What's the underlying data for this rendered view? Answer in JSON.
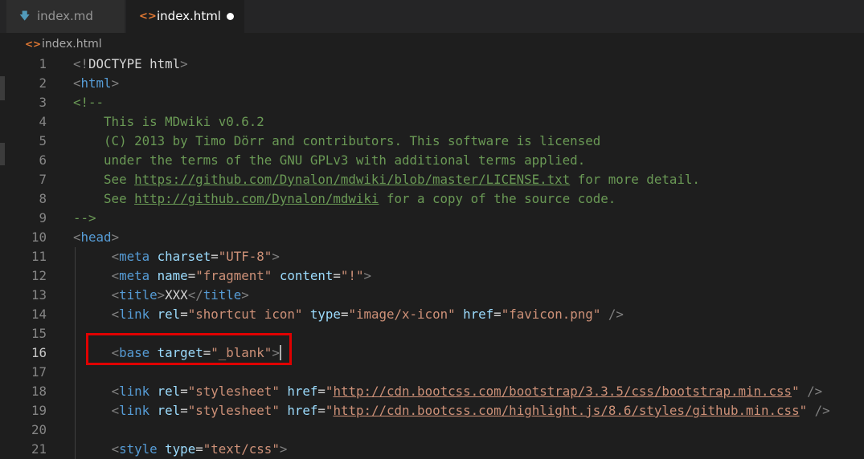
{
  "tabs": [
    {
      "label": "index.md",
      "icon": "markdown-file-icon",
      "active": false
    },
    {
      "label": "index.html",
      "icon": "html-file-icon",
      "active": true,
      "dirty": true
    }
  ],
  "breadcrumb": {
    "file": "index.html"
  },
  "editor": {
    "current_line": 16,
    "lines": [
      {
        "n": "1",
        "t": [
          [
            "punc",
            "<!"
          ],
          [
            "plain",
            "DOCTYPE html"
          ],
          [
            "punc",
            ">"
          ]
        ]
      },
      {
        "n": "2",
        "t": [
          [
            "punc",
            "<"
          ],
          [
            "tagn",
            "html"
          ],
          [
            "punc",
            ">"
          ]
        ]
      },
      {
        "n": "3",
        "t": [
          [
            "cmt",
            "<!--"
          ]
        ]
      },
      {
        "n": "4",
        "t": [
          [
            "cmt",
            "    This is MDwiki v0.6.2"
          ]
        ]
      },
      {
        "n": "5",
        "t": [
          [
            "cmt",
            "    (C) 2013 by Timo Dörr and contributors. This software is licensed"
          ]
        ]
      },
      {
        "n": "6",
        "t": [
          [
            "cmt",
            "    under the terms of the GNU GPLv3 with additional terms applied."
          ]
        ]
      },
      {
        "n": "7",
        "t": [
          [
            "cmt",
            "    See "
          ],
          [
            "cmt link",
            "https://github.com/Dynalon/mdwiki/blob/master/LICENSE.txt"
          ],
          [
            "cmt",
            " for more detail."
          ]
        ]
      },
      {
        "n": "8",
        "t": [
          [
            "cmt",
            "    See "
          ],
          [
            "cmt link",
            "http://github.com/Dynalon/mdwiki"
          ],
          [
            "cmt",
            " for a copy of the source code."
          ]
        ]
      },
      {
        "n": "9",
        "t": [
          [
            "cmt",
            "-->"
          ]
        ]
      },
      {
        "n": "10",
        "t": [
          [
            "punc",
            "<"
          ],
          [
            "tagn",
            "head"
          ],
          [
            "punc",
            ">"
          ]
        ]
      },
      {
        "n": "11",
        "t": [
          [
            "plain",
            "     "
          ],
          [
            "punc",
            "<"
          ],
          [
            "tagn",
            "meta"
          ],
          [
            "plain",
            " "
          ],
          [
            "attr",
            "charset"
          ],
          [
            "plain",
            "="
          ],
          [
            "str",
            "\"UTF-8\""
          ],
          [
            "punc",
            ">"
          ]
        ]
      },
      {
        "n": "12",
        "t": [
          [
            "plain",
            "     "
          ],
          [
            "punc",
            "<"
          ],
          [
            "tagn",
            "meta"
          ],
          [
            "plain",
            " "
          ],
          [
            "attr",
            "name"
          ],
          [
            "plain",
            "="
          ],
          [
            "str",
            "\"fragment\""
          ],
          [
            "plain",
            " "
          ],
          [
            "attr",
            "content"
          ],
          [
            "plain",
            "="
          ],
          [
            "str",
            "\"!\""
          ],
          [
            "punc",
            ">"
          ]
        ]
      },
      {
        "n": "13",
        "t": [
          [
            "plain",
            "     "
          ],
          [
            "punc",
            "<"
          ],
          [
            "tagn",
            "title"
          ],
          [
            "punc",
            ">"
          ],
          [
            "plain",
            "XXX"
          ],
          [
            "punc",
            "</"
          ],
          [
            "tagn",
            "title"
          ],
          [
            "punc",
            ">"
          ]
        ]
      },
      {
        "n": "14",
        "t": [
          [
            "plain",
            "     "
          ],
          [
            "punc",
            "<"
          ],
          [
            "tagn",
            "link"
          ],
          [
            "plain",
            " "
          ],
          [
            "attr",
            "rel"
          ],
          [
            "plain",
            "="
          ],
          [
            "str",
            "\"shortcut icon\""
          ],
          [
            "plain",
            " "
          ],
          [
            "attr",
            "type"
          ],
          [
            "plain",
            "="
          ],
          [
            "str",
            "\"image/x-icon\""
          ],
          [
            "plain",
            " "
          ],
          [
            "attr",
            "href"
          ],
          [
            "plain",
            "="
          ],
          [
            "str",
            "\"favicon.png\""
          ],
          [
            "plain",
            " "
          ],
          [
            "punc",
            "/>"
          ]
        ]
      },
      {
        "n": "15",
        "t": []
      },
      {
        "n": "16",
        "t": [
          [
            "plain",
            "     "
          ],
          [
            "punc",
            "<"
          ],
          [
            "tagn",
            "base"
          ],
          [
            "plain",
            " "
          ],
          [
            "attr",
            "target"
          ],
          [
            "plain",
            "="
          ],
          [
            "str",
            "\"_blank\""
          ],
          [
            "punc",
            ">"
          ]
        ]
      },
      {
        "n": "17",
        "t": []
      },
      {
        "n": "18",
        "t": [
          [
            "plain",
            "     "
          ],
          [
            "punc",
            "<"
          ],
          [
            "tagn",
            "link"
          ],
          [
            "plain",
            " "
          ],
          [
            "attr",
            "rel"
          ],
          [
            "plain",
            "="
          ],
          [
            "str",
            "\"stylesheet\""
          ],
          [
            "plain",
            " "
          ],
          [
            "attr",
            "href"
          ],
          [
            "plain",
            "="
          ],
          [
            "str",
            "\""
          ],
          [
            "str link",
            "http://cdn.bootcss.com/bootstrap/3.3.5/css/bootstrap.min.css"
          ],
          [
            "str",
            "\""
          ],
          [
            "plain",
            " "
          ],
          [
            "punc",
            "/>"
          ]
        ]
      },
      {
        "n": "19",
        "t": [
          [
            "plain",
            "     "
          ],
          [
            "punc",
            "<"
          ],
          [
            "tagn",
            "link"
          ],
          [
            "plain",
            " "
          ],
          [
            "attr",
            "rel"
          ],
          [
            "plain",
            "="
          ],
          [
            "str",
            "\"stylesheet\""
          ],
          [
            "plain",
            " "
          ],
          [
            "attr",
            "href"
          ],
          [
            "plain",
            "="
          ],
          [
            "str",
            "\""
          ],
          [
            "str link",
            "http://cdn.bootcss.com/highlight.js/8.6/styles/github.min.css"
          ],
          [
            "str",
            "\""
          ],
          [
            "plain",
            " "
          ],
          [
            "punc",
            "/>"
          ]
        ]
      },
      {
        "n": "20",
        "t": []
      },
      {
        "n": "21",
        "t": [
          [
            "plain",
            "     "
          ],
          [
            "punc",
            "<"
          ],
          [
            "tagn",
            "style"
          ],
          [
            "plain",
            " "
          ],
          [
            "attr",
            "type"
          ],
          [
            "plain",
            "="
          ],
          [
            "str",
            "\"text/css\""
          ],
          [
            "punc",
            ">"
          ]
        ]
      }
    ]
  }
}
